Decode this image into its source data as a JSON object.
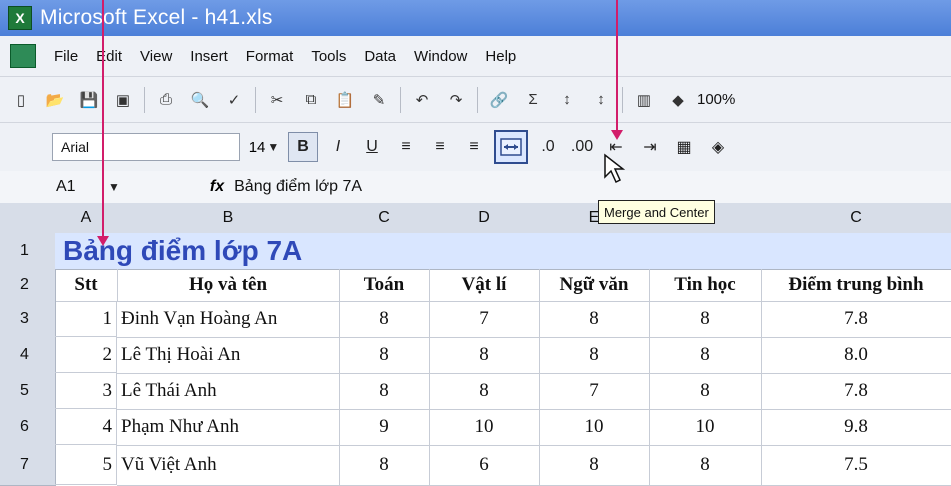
{
  "window": {
    "title": "Microsoft Excel - h41.xls",
    "app_icon": "X"
  },
  "menu": [
    "File",
    "Edit",
    "View",
    "Insert",
    "Format",
    "Tools",
    "Data",
    "Window",
    "Help"
  ],
  "toolbar": {
    "zoom": "100%"
  },
  "format_toolbar": {
    "font": "Arial",
    "size": "14",
    "bold": "B",
    "italic": "I",
    "underline": "U"
  },
  "formula_bar": {
    "name_box": "A1",
    "fx": "fx",
    "content": "Bảng điểm lớp 7A"
  },
  "tooltip": "Merge and Center",
  "columns": [
    "A",
    "B",
    "C",
    "D",
    "E",
    "",
    "C"
  ],
  "rows": [
    "1",
    "2",
    "3",
    "4",
    "5",
    "6",
    "7"
  ],
  "title_row": "Bảng điểm lớp 7A",
  "table_header": [
    "Stt",
    "Họ và tên",
    "Toán",
    "Vật lí",
    "Ngữ văn",
    "Tin học",
    "Điểm trung bình"
  ],
  "table": [
    [
      "1",
      "Đinh Vạn Hoàng An",
      "8",
      "7",
      "8",
      "8",
      "7.8"
    ],
    [
      "2",
      "Lê Thị Hoài An",
      "8",
      "8",
      "8",
      "8",
      "8.0"
    ],
    [
      "3",
      "Lê Thái Anh",
      "8",
      "8",
      "7",
      "8",
      "7.8"
    ],
    [
      "4",
      "Phạm Như Anh",
      "9",
      "10",
      "10",
      "10",
      "9.8"
    ],
    [
      "5",
      "Vũ Việt Anh",
      "8",
      "6",
      "8",
      "8",
      "7.5"
    ]
  ]
}
